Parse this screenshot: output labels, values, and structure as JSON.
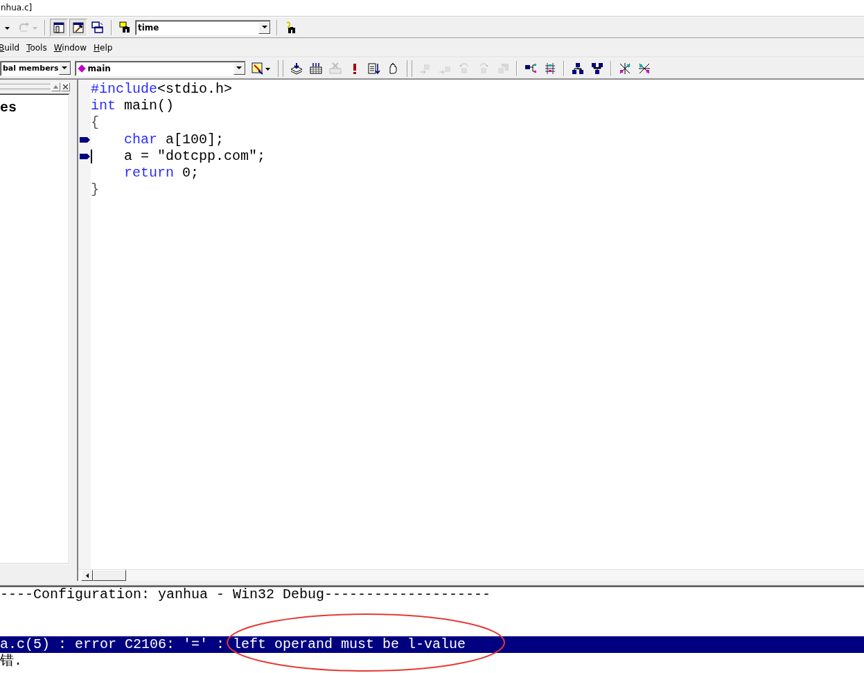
{
  "window": {
    "title": "nhua.c]"
  },
  "toolbar_top": {
    "items": [
      {
        "kind": "caret"
      },
      {
        "kind": "redo",
        "disabled": true
      },
      {
        "kind": "separator"
      },
      {
        "kind": "workspace",
        "pressed": true
      },
      {
        "kind": "output",
        "pressed": true
      },
      {
        "kind": "windows",
        "pressed": false
      },
      {
        "kind": "separator"
      },
      {
        "kind": "find_files",
        "pressed": false
      },
      {
        "kind": "combo",
        "value": "time"
      },
      {
        "kind": "separator"
      },
      {
        "kind": "find_help",
        "pressed": false
      }
    ]
  },
  "menu": {
    "items": [
      {
        "label": "Build"
      },
      {
        "label": "Tools"
      },
      {
        "label": "Window"
      },
      {
        "label": "Help"
      }
    ]
  },
  "toolbar_wizard": {
    "items": [
      {
        "kind": "combo",
        "value": "bal members"
      },
      {
        "kind": "combo",
        "value": "main",
        "diamond": true
      },
      {
        "kind": "wizard"
      },
      {
        "kind": "grip"
      },
      {
        "kind": "compile",
        "disabled": false
      },
      {
        "kind": "build",
        "disabled": false
      },
      {
        "kind": "stop_build",
        "disabled": true
      },
      {
        "kind": "execute",
        "disabled": false
      },
      {
        "kind": "go",
        "disabled": false
      },
      {
        "kind": "breakpoint",
        "disabled": false
      },
      {
        "kind": "grip"
      },
      {
        "kind": "step_into",
        "disabled": true
      },
      {
        "kind": "step_over",
        "disabled": true
      },
      {
        "kind": "step_out",
        "disabled": true
      },
      {
        "kind": "run_cursor",
        "disabled": true
      },
      {
        "kind": "apply_code",
        "disabled": true
      },
      {
        "kind": "separator"
      },
      {
        "kind": "tree_a",
        "disabled": false
      },
      {
        "kind": "tree_b",
        "disabled": false
      },
      {
        "kind": "separator"
      },
      {
        "kind": "net_a",
        "disabled": false
      },
      {
        "kind": "net_b",
        "disabled": false
      },
      {
        "kind": "separator"
      },
      {
        "kind": "cross_a",
        "disabled": false
      },
      {
        "kind": "cross_b",
        "disabled": false
      }
    ]
  },
  "workspace": {
    "text": "es"
  },
  "editor": {
    "lines": [
      {
        "marker": false,
        "cursor": false,
        "tokens": [
          {
            "text": "#include",
            "kind": "keyword"
          },
          {
            "text": "<stdio.h>",
            "kind": "plain"
          }
        ]
      },
      {
        "marker": false,
        "cursor": false,
        "tokens": [
          {
            "text": "int",
            "kind": "keyword"
          },
          {
            "text": " main()",
            "kind": "plain"
          }
        ]
      },
      {
        "marker": false,
        "cursor": false,
        "tokens": [
          {
            "text": "{",
            "kind": "brace"
          }
        ]
      },
      {
        "marker": true,
        "cursor": false,
        "tokens": [
          {
            "text": "    char",
            "kind": "keyword"
          },
          {
            "text": " a[100];",
            "kind": "plain"
          }
        ]
      },
      {
        "marker": true,
        "cursor": true,
        "tokens": [
          {
            "text": "    a = \"dotcpp.com\";",
            "kind": "plain"
          }
        ]
      },
      {
        "marker": false,
        "cursor": false,
        "tokens": [
          {
            "text": "    return",
            "kind": "keyword"
          },
          {
            "text": " 0;",
            "kind": "plain"
          }
        ]
      },
      {
        "marker": false,
        "cursor": false,
        "tokens": [
          {
            "text": "}",
            "kind": "brace"
          }
        ]
      }
    ]
  },
  "output": {
    "lines": [
      {
        "text": "----Configuration: yanhua - Win32 Debug--------------------",
        "selected": false
      },
      {
        "text": "a.c(5) : error C2106: '=' : left operand must be l-value",
        "selected": true
      },
      {
        "text": "错.",
        "selected": false
      }
    ]
  }
}
